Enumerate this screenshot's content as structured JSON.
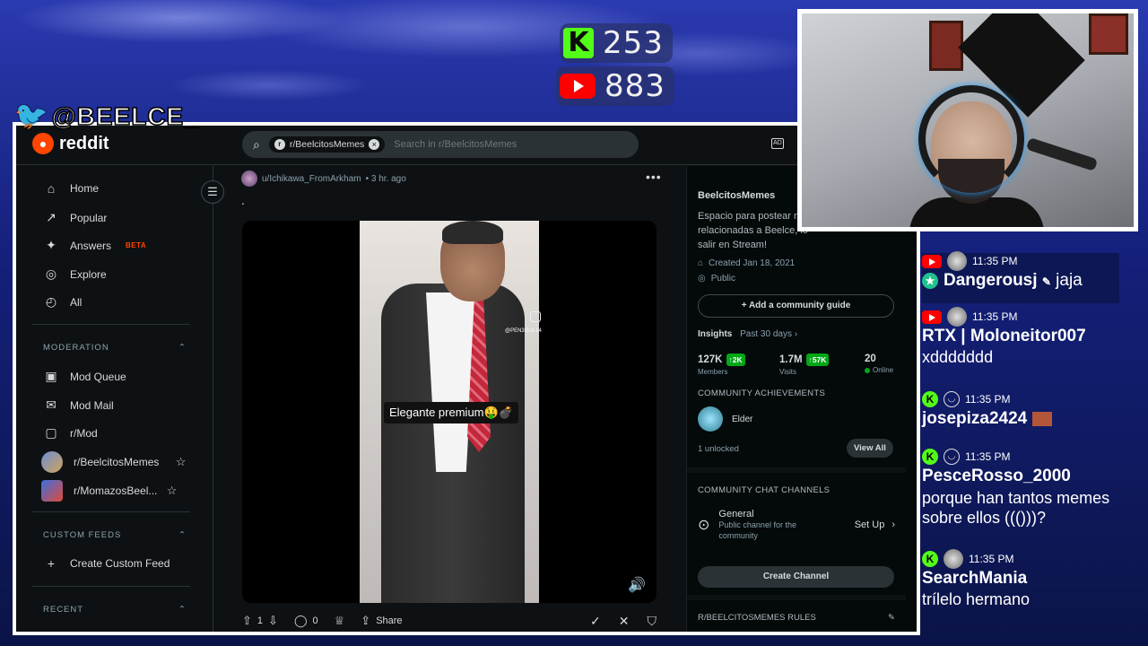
{
  "overlay": {
    "kick_count": "253",
    "youtube_count": "883",
    "twitter_handle": "@BEELCE_"
  },
  "reddit": {
    "logo_text": "reddit",
    "search": {
      "chip": "r/BeelcitosMemes",
      "placeholder": "Search in r/BeelcitosMemes"
    },
    "sidebar": {
      "items": [
        {
          "label": "Home",
          "icon": "home-icon"
        },
        {
          "label": "Popular",
          "icon": "popular-icon"
        },
        {
          "label": "Answers",
          "icon": "answers-icon",
          "badge": "BETA"
        },
        {
          "label": "Explore",
          "icon": "explore-icon"
        },
        {
          "label": "All",
          "icon": "all-icon"
        }
      ],
      "moderation_header": "MODERATION",
      "moderation": [
        {
          "label": "Mod Queue"
        },
        {
          "label": "Mod Mail"
        },
        {
          "label": "r/Mod"
        },
        {
          "label": "r/BeelcitosMemes"
        },
        {
          "label": "r/MomazosBeel..."
        }
      ],
      "custom_feeds_header": "CUSTOM FEEDS",
      "create_custom_feed": "Create Custom Feed",
      "recent_header": "RECENT"
    },
    "post": {
      "author": "u/Ichikawa_FromArkham",
      "time": "• 3 hr. ago",
      "title": ".",
      "caption": "Elegante premium🤑💣",
      "ig_handle": "@PEN3GUL14",
      "upvotes": "1",
      "comments": "0",
      "share_label": "Share"
    },
    "community": {
      "name": "BeelcitosMemes",
      "description": "Espacio para postear me relacionadas a Beelce, lo salir en Stream!",
      "created": "Created Jan 18, 2021",
      "visibility": "Public",
      "add_guide": "Add a community guide",
      "insights_label": "Insights",
      "insights_range": "Past 30 days",
      "stats": [
        {
          "value": "127K",
          "delta": "↑2K",
          "label": "Members"
        },
        {
          "value": "1.7M",
          "delta": "↑57K",
          "label": "Visits"
        },
        {
          "value": "20",
          "delta": "",
          "label": "Online"
        }
      ],
      "achievements_header": "COMMUNITY ACHIEVEMENTS",
      "achievement": "Elder",
      "unlocked": "1 unlocked",
      "view_all": "View All",
      "chat_header": "COMMUNITY CHAT CHANNELS",
      "channel_name": "General",
      "channel_desc": "Public channel for the community",
      "setup": "Set Up",
      "create_channel": "Create Channel",
      "rules_header": "R/BEELCITOSMEMES RULES"
    }
  },
  "chat": [
    {
      "platform": "youtube",
      "time": "11:35 PM",
      "name": "Dangerousj",
      "text": "jaja",
      "inline": true
    },
    {
      "platform": "youtube",
      "time": "11:35 PM",
      "name": "RTX | Moloneitor007",
      "text": "xddddddd"
    },
    {
      "platform": "kick",
      "time": "11:35 PM",
      "name": "josepiza2424",
      "text": ""
    },
    {
      "platform": "kick",
      "time": "11:35 PM",
      "name": "PesceRosso_2000",
      "text": "porque han tantos memes sobre ellos ((()))?"
    },
    {
      "platform": "kick",
      "time": "11:35 PM",
      "name": "SearchMania",
      "text": "trílelo hermano"
    }
  ]
}
